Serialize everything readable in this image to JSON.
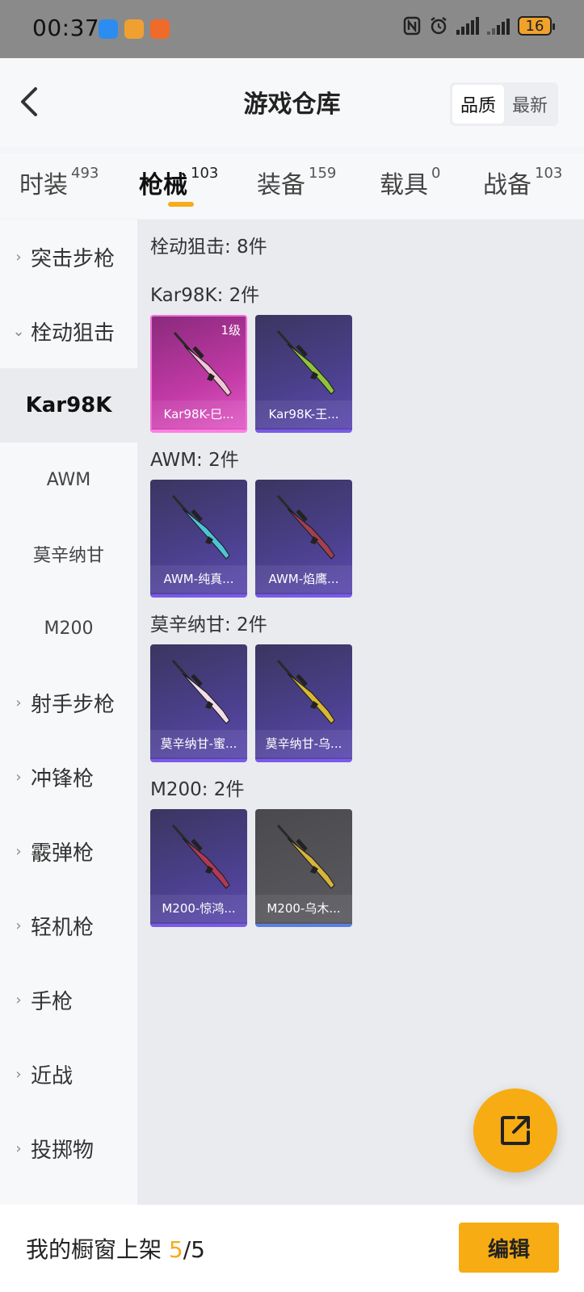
{
  "status_bar": {
    "time": "00:37",
    "battery": "16",
    "app_icons": [
      {
        "name": "chat-app-icon",
        "color": "#2d8cf0"
      },
      {
        "name": "game-app-icon",
        "color": "#f0a030"
      },
      {
        "name": "shop-app-icon",
        "color": "#f06a2a"
      }
    ]
  },
  "header": {
    "title": "游戏仓库",
    "sort_options": [
      "品质",
      "最新"
    ],
    "sort_selected": "品质"
  },
  "tabs": [
    {
      "label": "时装",
      "count": "493",
      "active": false
    },
    {
      "label": "枪械",
      "count": "103",
      "active": true
    },
    {
      "label": "装备",
      "count": "159",
      "active": false
    },
    {
      "label": "载具",
      "count": "0",
      "active": false
    },
    {
      "label": "战备",
      "count": "103",
      "active": false
    }
  ],
  "sidebar": {
    "categories": [
      {
        "label": "突击步枪",
        "expanded": false
      },
      {
        "label": "栓动狙击",
        "expanded": true
      },
      {
        "label": "射手步枪",
        "expanded": false
      },
      {
        "label": "冲锋枪",
        "expanded": false
      },
      {
        "label": "霰弹枪",
        "expanded": false
      },
      {
        "label": "轻机枪",
        "expanded": false
      },
      {
        "label": "手枪",
        "expanded": false
      },
      {
        "label": "近战",
        "expanded": false
      },
      {
        "label": "投掷物",
        "expanded": false
      }
    ],
    "subcategories": [
      {
        "label": "Kar98K",
        "active": true
      },
      {
        "label": "AWM",
        "active": false
      },
      {
        "label": "莫辛纳甘",
        "active": false
      },
      {
        "label": "M200",
        "active": false
      }
    ]
  },
  "content": {
    "header": "栓动狙击: 8件",
    "groups": [
      {
        "title": "Kar98K: 2件",
        "items": [
          {
            "name": "Kar98K-巳...",
            "level": "1级",
            "rarity": "pink",
            "gun_color": "#f2c6d8"
          },
          {
            "name": "Kar98K-王...",
            "level": "",
            "rarity": "purple",
            "gun_color": "#8fc43a"
          }
        ]
      },
      {
        "title": "AWM: 2件",
        "items": [
          {
            "name": "AWM-纯真...",
            "level": "",
            "rarity": "purple",
            "gun_color": "#4fc3d6"
          },
          {
            "name": "AWM-焰鹰...",
            "level": "",
            "rarity": "purple",
            "gun_color": "#a04050"
          }
        ]
      },
      {
        "title": "莫辛纳甘: 2件",
        "items": [
          {
            "name": "莫辛纳甘-蜜...",
            "level": "",
            "rarity": "purple",
            "gun_color": "#f3dde8"
          },
          {
            "name": "莫辛纳甘-乌...",
            "level": "",
            "rarity": "purple",
            "gun_color": "#d8b830"
          }
        ]
      },
      {
        "title": "M200: 2件",
        "items": [
          {
            "name": "M200-惊鸿...",
            "level": "",
            "rarity": "purple",
            "gun_color": "#b03a55"
          },
          {
            "name": "M200-乌木...",
            "level": "",
            "rarity": "gray",
            "gun_color": "#d7b43a"
          }
        ]
      }
    ]
  },
  "bottom_bar": {
    "label": "我的橱窗上架",
    "current": "5",
    "total": "/5",
    "edit_label": "编辑"
  },
  "colors": {
    "accent": "#f7ac14",
    "rarity_purple": "#7a5ae6",
    "rarity_pink": "#f06fd8"
  }
}
